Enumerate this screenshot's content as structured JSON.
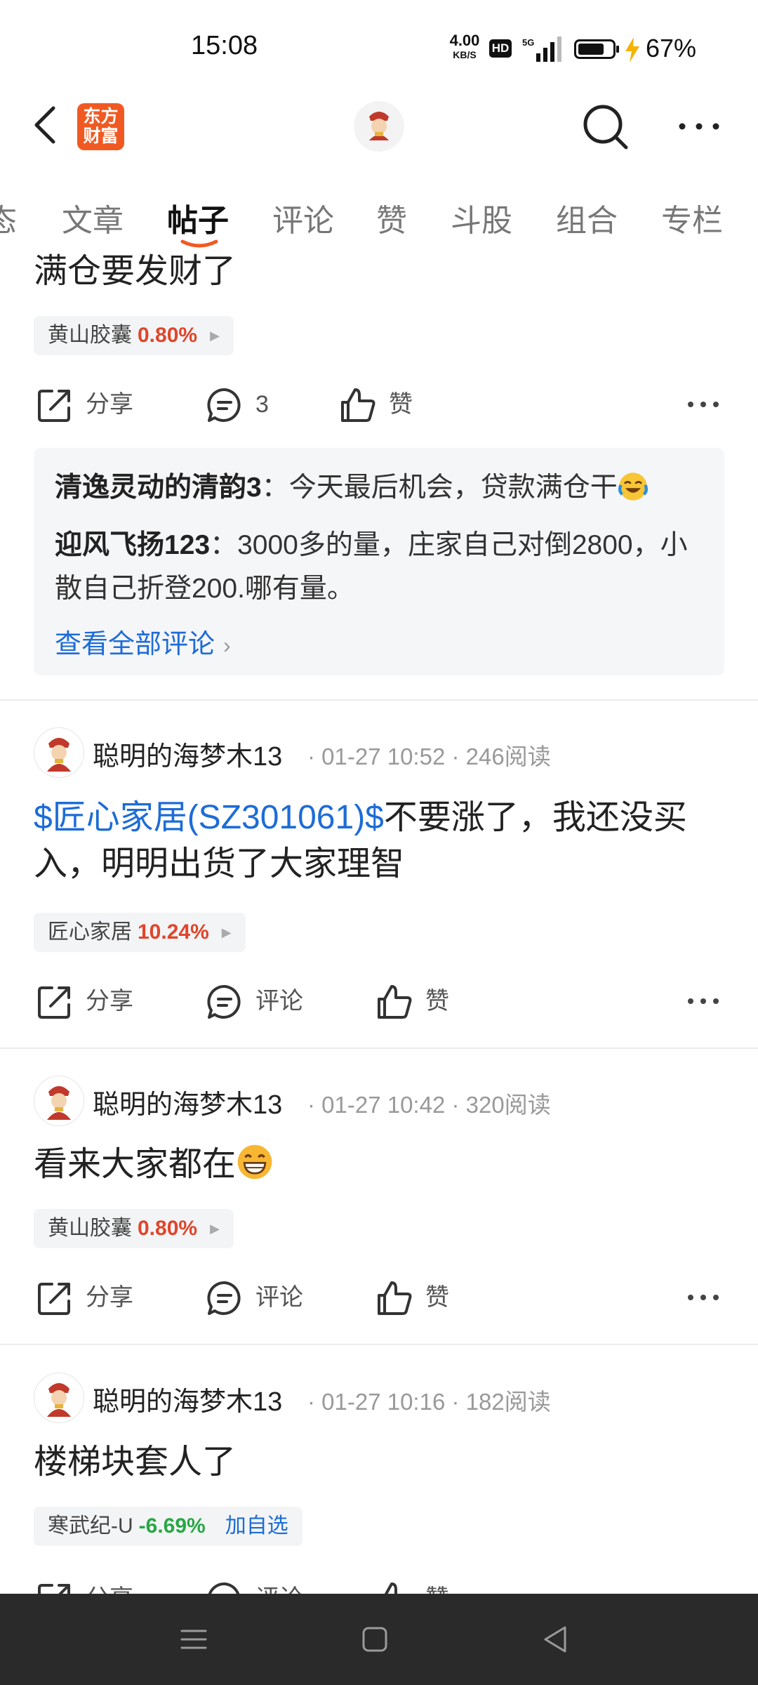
{
  "status_bar": {
    "time": "15:08",
    "net_speed": "4.00",
    "net_unit": "KB/S",
    "hd": "HD",
    "signal": "5G",
    "battery": "67%"
  },
  "header": {
    "brand_line1": "东方",
    "brand_line2": "财富"
  },
  "tabs": [
    {
      "label": "态",
      "active": false
    },
    {
      "label": "文章",
      "active": false
    },
    {
      "label": "帖子",
      "active": true
    },
    {
      "label": "评论",
      "active": false
    },
    {
      "label": "赞",
      "active": false
    },
    {
      "label": "斗股",
      "active": false
    },
    {
      "label": "组合",
      "active": false
    },
    {
      "label": "专栏",
      "active": false
    }
  ],
  "post0": {
    "text": "满仓要发财了",
    "stock_name": "黄山胶囊",
    "stock_pct": "0.80%",
    "share": "分享",
    "comment_count": "3",
    "like": "赞",
    "comments": [
      {
        "author": "清逸灵动的清韵3",
        "sep": "：",
        "text": "今天最后机会，贷款满仓干"
      },
      {
        "author": "迎风飞扬123",
        "sep": "：",
        "text": "3000多的量，庄家自己对倒2800，小散自己折登200.哪有量。"
      }
    ],
    "view_all": "查看全部评论"
  },
  "post1": {
    "author": "聪明的海梦木13",
    "meta": "· 01-27 10:52 · 246阅读",
    "link_text": "$匠心家居(SZ301061)$",
    "text": "不要涨了，我还没买入，明明出货了大家理智",
    "stock_name": "匠心家居",
    "stock_pct": "10.24%",
    "share": "分享",
    "comment": "评论",
    "like": "赞"
  },
  "post2": {
    "author": "聪明的海梦木13",
    "meta": "· 01-27 10:42 · 320阅读",
    "text": "看来大家都在",
    "stock_name": "黄山胶囊",
    "stock_pct": "0.80%",
    "share": "分享",
    "comment": "评论",
    "like": "赞"
  },
  "post3": {
    "author": "聪明的海梦木13",
    "meta": "· 01-27 10:16 · 182阅读",
    "text": "楼梯块套人了",
    "stock_name": "寒武纪-U",
    "stock_pct": "-6.69%",
    "add_watch": "加自选",
    "share": "分享",
    "comment": "评论",
    "like": "赞"
  },
  "colors": {
    "brand": "#f05a22",
    "link": "#1d6cd7",
    "up": "#e0452b",
    "down": "#28a745",
    "navbar": "#2a2a2a"
  }
}
